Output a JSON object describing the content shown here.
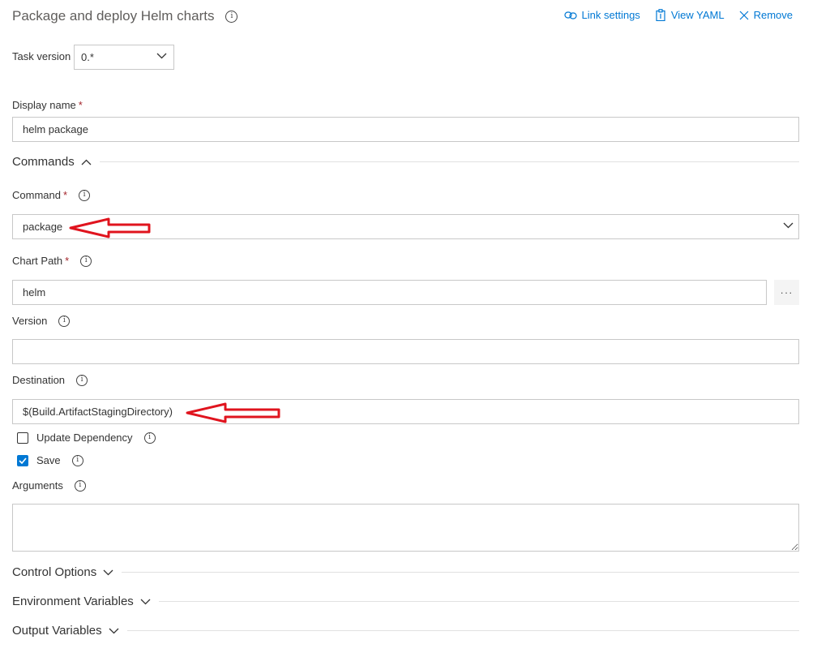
{
  "task": {
    "title": "Package and deploy Helm charts",
    "links": {
      "link_settings": "Link settings",
      "view_yaml": "View YAML",
      "remove": "Remove"
    },
    "version_label": "Task version",
    "version_value": "0.*"
  },
  "display_name": {
    "label": "Display name",
    "required": "*",
    "value": "helm package"
  },
  "commands_section": "Commands",
  "command": {
    "label": "Command",
    "required": "*",
    "value": "package"
  },
  "chart_path": {
    "label": "Chart Path",
    "required": "*",
    "value": "helm",
    "browse": "···"
  },
  "version": {
    "label": "Version",
    "value": ""
  },
  "destination": {
    "label": "Destination",
    "value": "$(Build.ArtifactStagingDirectory)"
  },
  "update_dependency": {
    "label": "Update Dependency",
    "checked": false
  },
  "save": {
    "label": "Save",
    "checked": true
  },
  "arguments": {
    "label": "Arguments",
    "value": ""
  },
  "sections": {
    "control_options": "Control Options",
    "environment_variables": "Environment Variables",
    "output_variables": "Output Variables"
  },
  "colors": {
    "accent": "#0078d4",
    "required": "#a4262c",
    "annotation_arrow": "#e0141e"
  },
  "icons": {
    "info": "info-icon",
    "link": "link-icon",
    "yaml": "clipboard-icon",
    "remove": "close-icon",
    "chevron": "chevron-icon"
  }
}
